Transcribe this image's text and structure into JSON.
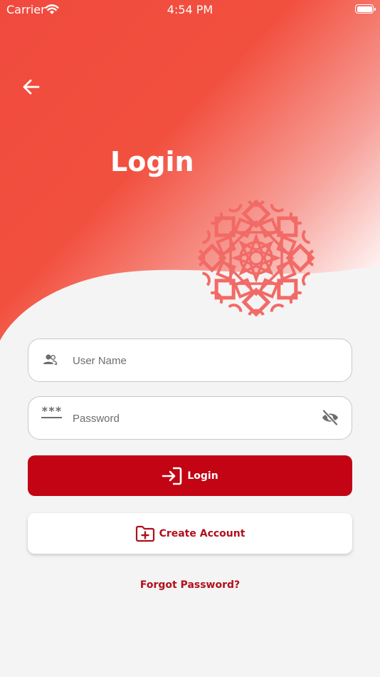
{
  "status_bar": {
    "carrier": "Carrier",
    "time": "4:54 PM"
  },
  "header": {
    "title": "Login"
  },
  "form": {
    "username": {
      "value": "",
      "placeholder": "User Name"
    },
    "password": {
      "value": "",
      "placeholder": "Password",
      "mask_hint": "***"
    }
  },
  "actions": {
    "login_label": "Login",
    "create_account_label": "Create Account",
    "forgot_password_label": "Forgot Password?"
  },
  "colors": {
    "primary": "#c20414",
    "header_gradient_start": "#f04a3e",
    "header_gradient_end": "#ffffff",
    "ornament": "#f26a66",
    "background": "#f4f4f4"
  },
  "icons": {
    "back": "arrow-left-icon",
    "username": "users-icon",
    "password": "password-dots-icon",
    "toggle_visibility": "eye-off-icon",
    "login": "sign-in-icon",
    "create_account": "folder-plus-icon"
  }
}
